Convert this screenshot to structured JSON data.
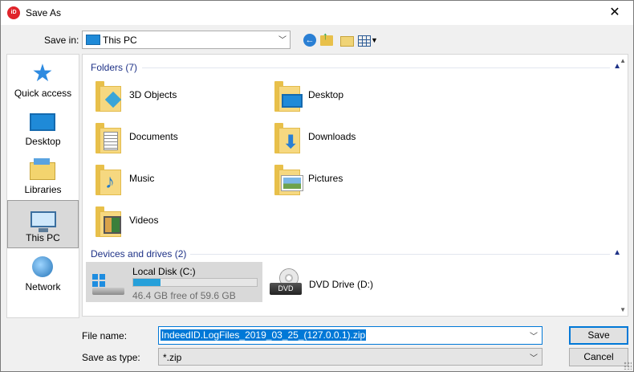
{
  "window": {
    "title": "Save As",
    "app_icon_text": "iD",
    "close_glyph": "✕"
  },
  "toolbar": {
    "save_in_label": "Save in:",
    "save_in_value": "This PC"
  },
  "nav": {
    "items": [
      {
        "label": "Quick access"
      },
      {
        "label": "Desktop"
      },
      {
        "label": "Libraries"
      },
      {
        "label": "This PC",
        "selected": true
      },
      {
        "label": "Network"
      }
    ]
  },
  "folders": {
    "header": "Folders (7)",
    "items": [
      {
        "name": "3D Objects"
      },
      {
        "name": "Desktop"
      },
      {
        "name": "Documents"
      },
      {
        "name": "Downloads"
      },
      {
        "name": "Music"
      },
      {
        "name": "Pictures"
      },
      {
        "name": "Videos"
      }
    ]
  },
  "drives": {
    "header": "Devices and drives (2)",
    "local": {
      "name": "Local Disk (C:)",
      "free_text": "46.4 GB free of 59.6 GB",
      "used_fraction": 0.22
    },
    "dvd": {
      "name": "DVD Drive (D:)",
      "badge": "DVD"
    }
  },
  "footer": {
    "file_name_label": "File name:",
    "file_name_value": "IndeedID.LogFiles_2019_03_25_(127.0.0.1).zip",
    "save_type_label": "Save as type:",
    "save_type_value": "*.zip",
    "save_button": "Save",
    "cancel_button": "Cancel"
  },
  "colors": {
    "accent": "#0078d7",
    "group_header": "#1e3287",
    "progress": "#26a0da"
  }
}
